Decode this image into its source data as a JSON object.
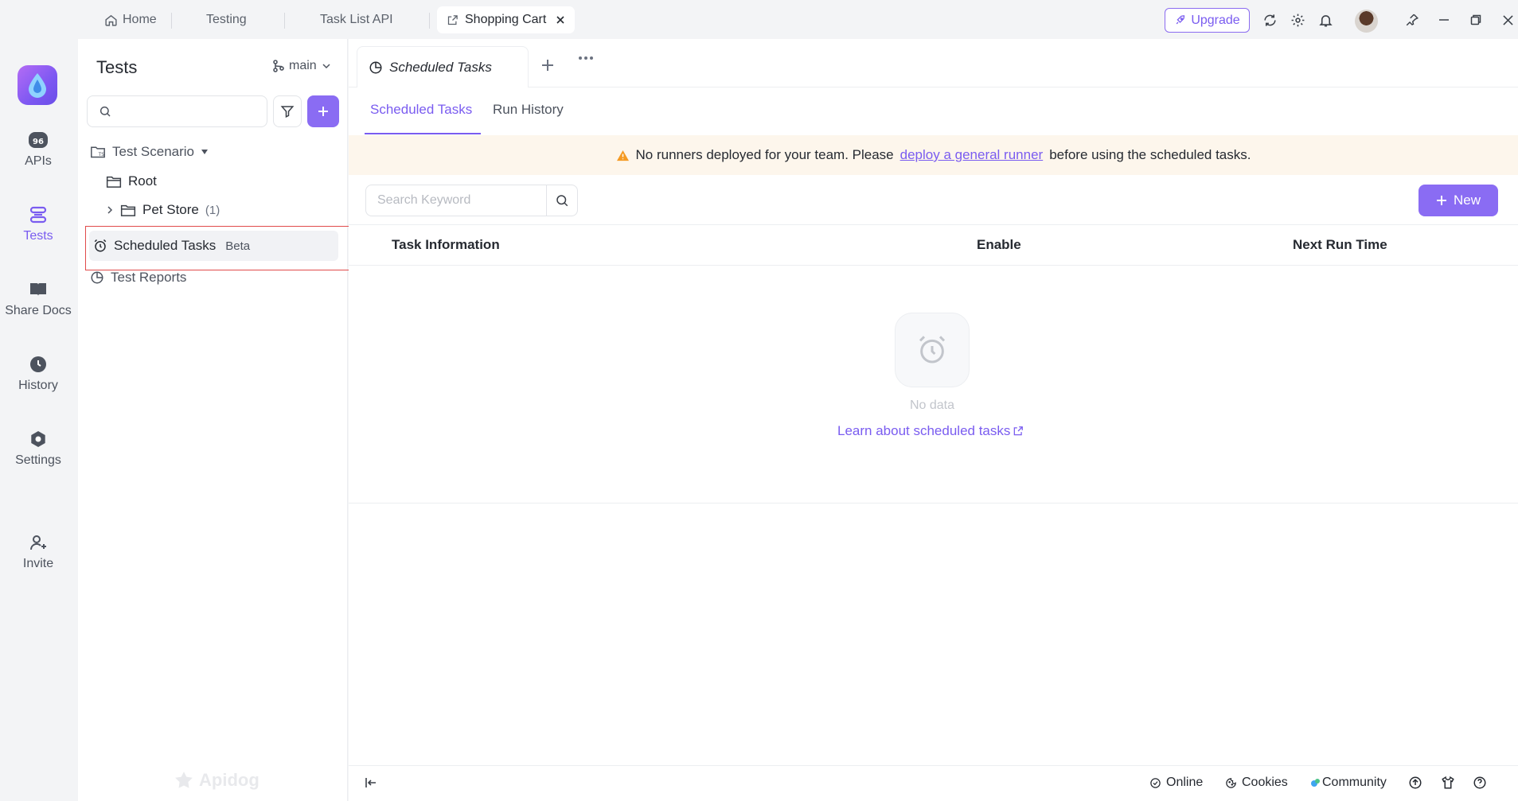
{
  "titlebar": {
    "tabs": [
      {
        "label": "Home"
      },
      {
        "label": "Testing"
      },
      {
        "label": "Task List API"
      },
      {
        "label": "Shopping Cart"
      }
    ],
    "upgrade_label": "Upgrade"
  },
  "rail": {
    "items": [
      {
        "label": "APIs"
      },
      {
        "label": "Tests"
      },
      {
        "label": "Share Docs"
      },
      {
        "label": "History"
      },
      {
        "label": "Settings"
      },
      {
        "label": "Invite"
      }
    ]
  },
  "tests_panel": {
    "title": "Tests",
    "branch": "main",
    "tree": {
      "scenario": "Test Scenario",
      "root": "Root",
      "pet_store": "Pet Store",
      "pet_store_count": "(1)",
      "scheduled": "Scheduled Tasks",
      "beta": "Beta",
      "reports": "Test Reports"
    },
    "watermark": "Apidog"
  },
  "main": {
    "doc_tab": "Scheduled Tasks",
    "subtabs": [
      "Scheduled Tasks",
      "Run History"
    ],
    "banner": {
      "before": "No runners deployed for your team. Please",
      "link": "deploy a general runner",
      "after": "before using the scheduled tasks."
    },
    "search_placeholder": "Search Keyword",
    "new_label": "New",
    "columns": [
      "Task Information",
      "Enable",
      "Next Run Time"
    ],
    "empty": {
      "text": "No data",
      "link": "Learn about scheduled tasks"
    }
  },
  "statusbar": {
    "online": "Online",
    "cookies": "Cookies",
    "community": "Community"
  },
  "colors": {
    "accent": "#7a5cf0",
    "button": "#8a6cf3",
    "banner_bg": "#fdf6ec",
    "warning": "#f59a23",
    "highlight_border": "#e14b4b"
  }
}
